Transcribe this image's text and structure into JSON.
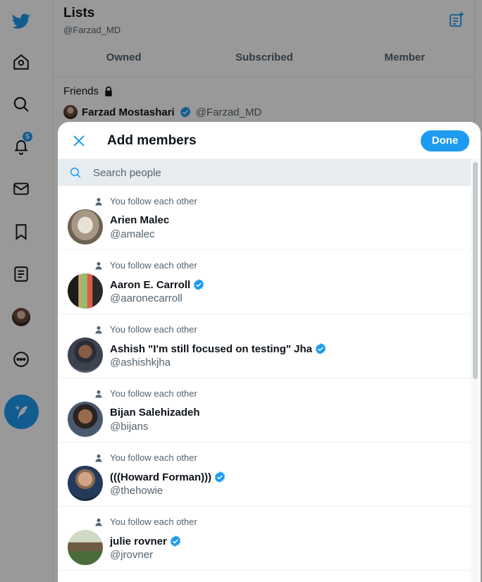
{
  "lists_header": {
    "title": "Lists",
    "handle": "@Farzad_MD"
  },
  "tabs": [
    {
      "label": "Owned"
    },
    {
      "label": "Subscribed"
    },
    {
      "label": "Member"
    }
  ],
  "list": {
    "name": "Friends",
    "owner_name": "Farzad Mostashari",
    "owner_handle": "@Farzad_MD"
  },
  "nav": {
    "notification_count": "5"
  },
  "modal": {
    "title": "Add members",
    "done_label": "Done",
    "search_placeholder": "Search people"
  },
  "people": [
    {
      "context": "You follow each other",
      "name": "Arien Malec",
      "handle": "@amalec",
      "verified": false
    },
    {
      "context": "You follow each other",
      "name": "Aaron E. Carroll",
      "handle": "@aaronecarroll",
      "verified": true
    },
    {
      "context": "You follow each other",
      "name": "Ashish \"I'm still focused on testing\" Jha",
      "handle": "@ashishkjha",
      "verified": true
    },
    {
      "context": "You follow each other",
      "name": "Bijan Salehizadeh",
      "handle": "@bijans",
      "verified": false
    },
    {
      "context": "You follow each other",
      "name": "(((Howard Forman)))",
      "handle": "@thehowie",
      "verified": true
    },
    {
      "context": "You follow each other",
      "name": "julie rovner",
      "handle": "@jrovner",
      "verified": true
    }
  ],
  "colors": {
    "accent": "#1d9bf0",
    "text_primary": "#0f1419",
    "text_secondary": "#536471",
    "search_bg": "#e6ecf0"
  },
  "icons": {
    "nav": [
      "twitter-logo-icon",
      "home-icon",
      "explore-icon",
      "notifications-icon",
      "messages-icon",
      "bookmarks-icon",
      "lists-icon",
      "profile-avatar",
      "more-icon",
      "compose-tweet-icon"
    ],
    "modal": [
      "close-icon",
      "search-icon",
      "person-icon",
      "verified-badge-icon"
    ]
  }
}
